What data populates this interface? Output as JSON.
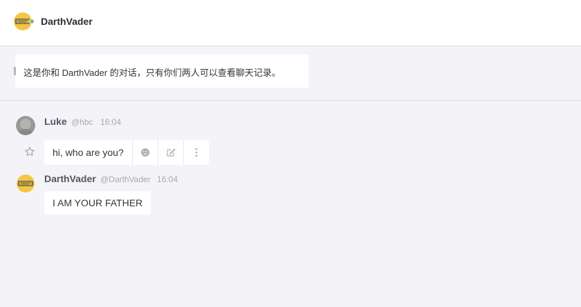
{
  "header": {
    "title": "DarthVader"
  },
  "notice": {
    "text": "这是你和 DarthVader 的对话，只有你们两人可以查看聊天记录。"
  },
  "messages": [
    {
      "sender": "Luke",
      "handle": "@hbc",
      "time": "16:04",
      "text": "hi, who are you?"
    },
    {
      "sender": "DarthVader",
      "handle": "@DarthVader",
      "time": "16:04",
      "text": "I AM YOUR FATHER"
    }
  ],
  "icons": {
    "star": "star-icon",
    "emoji": "emoji-icon",
    "edit": "edit-icon",
    "more": "more-vertical-icon"
  },
  "colors": {
    "background": "#f4f3f8",
    "online": "#7dc35b",
    "muted": "#a9a8b4"
  }
}
